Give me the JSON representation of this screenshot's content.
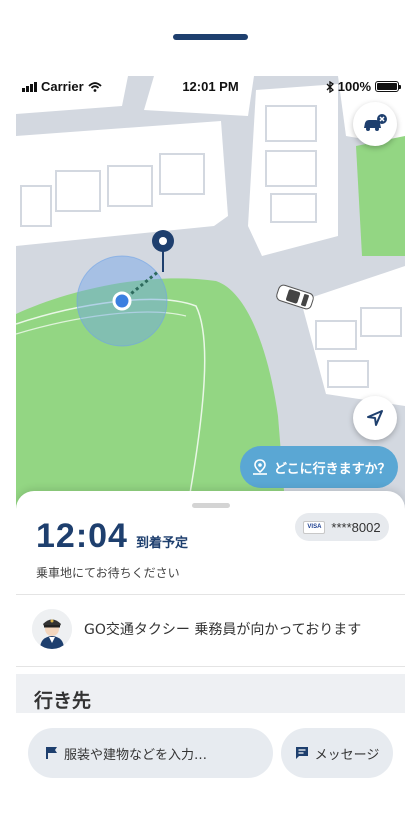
{
  "status_bar": {
    "carrier": "Carrier",
    "time": "12:01 PM",
    "battery": "100%"
  },
  "map": {
    "destination_prompt": "どこに行きますか？",
    "car_button_icon": "car-cancel-icon",
    "locate_button_icon": "navigation-arrow-icon",
    "colors": {
      "road": "#d3d8e0",
      "block": "#ffffff",
      "park": "#93d683",
      "user_dot": "#3b7fe0"
    }
  },
  "sheet": {
    "eta_time": "12:04",
    "eta_label": "到着予定",
    "wait_text": "乗車地にてお待ちください",
    "card_brand": "VISA",
    "card_number": "****8002",
    "driver_status": "GO交通タクシー 乗務員が向かっております",
    "destination_section_title": "行き先"
  },
  "bottom_bar": {
    "input_placeholder": "服装や建物などを入力…",
    "message_label": "メッセージ"
  },
  "colors": {
    "accent_navy": "#1e3f6e",
    "destination_pill": "#5aa7d4",
    "pill_bg": "#e7ebf0"
  }
}
